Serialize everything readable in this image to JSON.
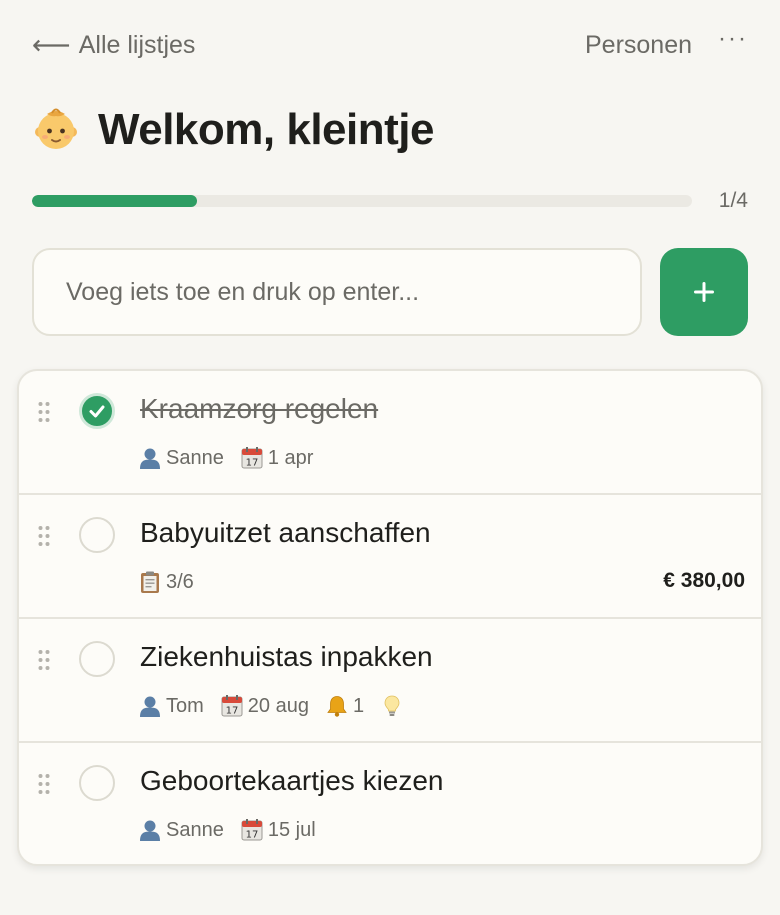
{
  "nav": {
    "back_label": "Alle lijstjes",
    "back_icon": "arrow-left-icon",
    "persons_label": "Personen",
    "more_label": "···"
  },
  "header": {
    "emoji": "baby-icon",
    "title": "Welkom, kleintje"
  },
  "progress": {
    "completed": 1,
    "total": 4,
    "label": "1/4",
    "fill_fraction": 0.25
  },
  "add_item": {
    "placeholder": "Voeg iets toe en druk op enter...",
    "button_label": "+"
  },
  "colors": {
    "accent": "#2e9d63",
    "background": "#f7f6f2",
    "card": "#fdfcf8",
    "muted_text": "#6b6a65"
  },
  "tasks": [
    {
      "title": "Kraamzorg regelen",
      "done": true,
      "person": "Sanne",
      "date": "1 apr"
    },
    {
      "title": "Babyuitzet aanschaffen",
      "done": false,
      "checklist": "3/6",
      "price": "€ 380,00"
    },
    {
      "title": "Ziekenhuistas inpakken",
      "done": false,
      "person": "Tom",
      "date": "20 aug",
      "reminders": "1",
      "has_idea": true
    },
    {
      "title": "Geboortekaartjes kiezen",
      "done": false,
      "person": "Sanne",
      "date": "15 jul"
    }
  ]
}
